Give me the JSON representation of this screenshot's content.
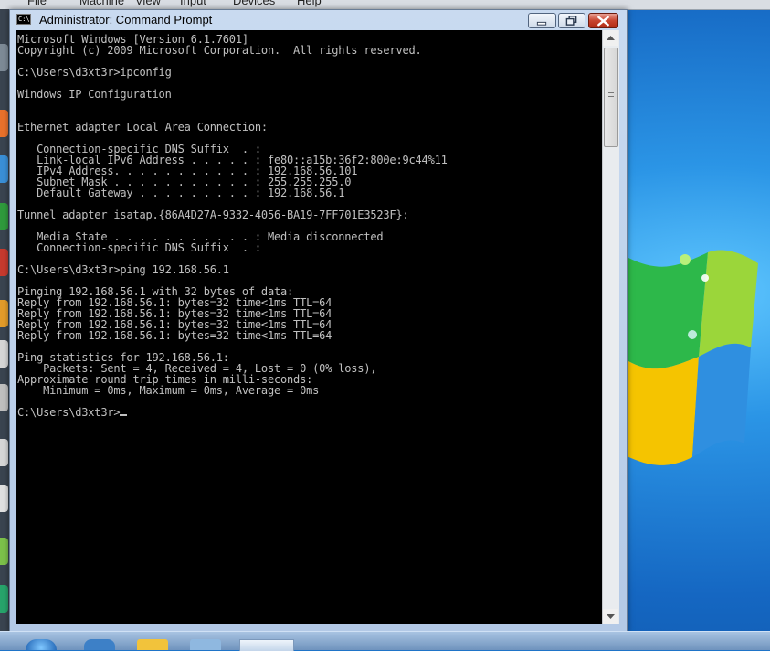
{
  "host_menu": [
    "File",
    "Machine",
    "View",
    "Input",
    "Devices",
    "Help"
  ],
  "window": {
    "title": "Administrator: Command Prompt",
    "icon_text": "C:\\"
  },
  "console_lines": [
    "Microsoft Windows [Version 6.1.7601]",
    "Copyright (c) 2009 Microsoft Corporation.  All rights reserved.",
    "",
    "C:\\Users\\d3xt3r>ipconfig",
    "",
    "Windows IP Configuration",
    "",
    "",
    "Ethernet adapter Local Area Connection:",
    "",
    "   Connection-specific DNS Suffix  . :",
    "   Link-local IPv6 Address . . . . . : fe80::a15b:36f2:800e:9c44%11",
    "   IPv4 Address. . . . . . . . . . . : 192.168.56.101",
    "   Subnet Mask . . . . . . . . . . . : 255.255.255.0",
    "   Default Gateway . . . . . . . . . : 192.168.56.1",
    "",
    "Tunnel adapter isatap.{86A4D27A-9332-4056-BA19-7FF701E3523F}:",
    "",
    "   Media State . . . . . . . . . . . : Media disconnected",
    "   Connection-specific DNS Suffix  . :",
    "",
    "C:\\Users\\d3xt3r>ping 192.168.56.1",
    "",
    "Pinging 192.168.56.1 with 32 bytes of data:",
    "Reply from 192.168.56.1: bytes=32 time<1ms TTL=64",
    "Reply from 192.168.56.1: bytes=32 time<1ms TTL=64",
    "Reply from 192.168.56.1: bytes=32 time<1ms TTL=64",
    "Reply from 192.168.56.1: bytes=32 time<1ms TTL=64",
    "",
    "Ping statistics for 192.168.56.1:",
    "    Packets: Sent = 4, Received = 4, Lost = 0 (0% loss),",
    "Approximate round trip times in milli-seconds:",
    "    Minimum = 0ms, Maximum = 0ms, Average = 0ms",
    "",
    "C:\\Users\\d3xt3r>"
  ],
  "icons": {
    "window_icon": "cmd-icon",
    "minimize": "minimize-icon",
    "maximize": "maximize-icon",
    "close": "close-icon",
    "scroll_up": "arrow-up-icon",
    "scroll_down": "arrow-down-icon"
  },
  "colors": {
    "console_bg": "#000000",
    "console_fg": "#c0c0c0",
    "close_button": "#c8452f",
    "desktop_blue": "#1f74c8"
  }
}
